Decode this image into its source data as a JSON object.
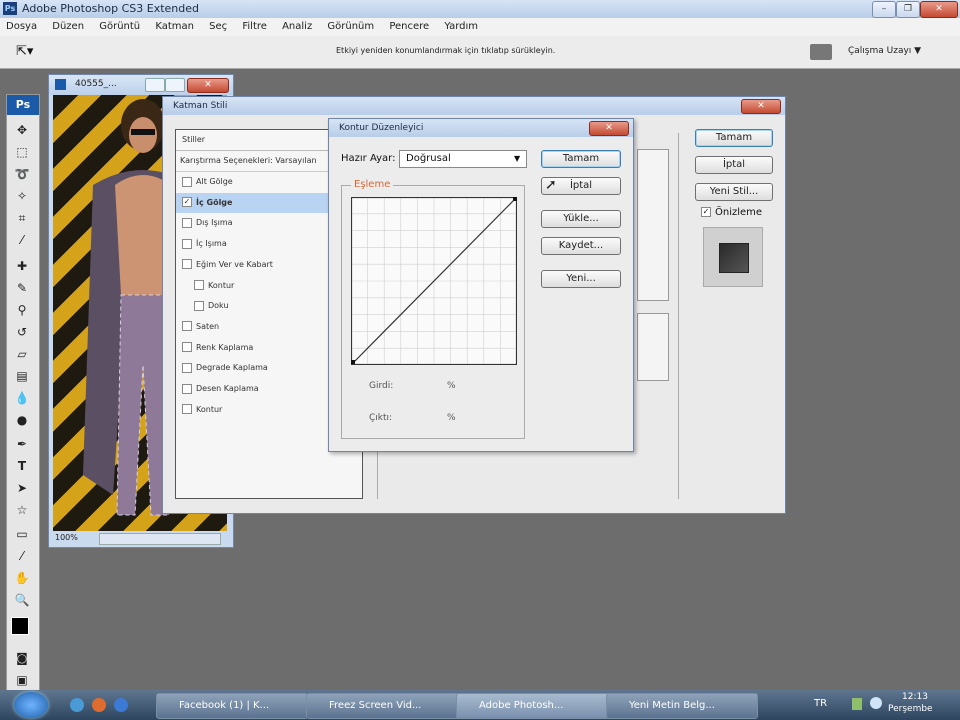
{
  "app": {
    "title": "Adobe Photoshop CS3 Extended",
    "ps_badge": "Ps"
  },
  "window_controls": {
    "minimize": "–",
    "restore": "❐",
    "close": "✕"
  },
  "menu": [
    "Dosya",
    "Düzen",
    "Görüntü",
    "Katman",
    "Seç",
    "Filtre",
    "Analiz",
    "Görünüm",
    "Pencere",
    "Yardım"
  ],
  "options": {
    "hint": "Etkiyi yeniden konumlandırmak için tıklatıp sürükleyin.",
    "workspace": "Çalışma Uzayı ▼"
  },
  "document": {
    "title": "40555_...",
    "zoom": "100%"
  },
  "layer_style": {
    "title": "Katman Stili",
    "list_header": "Stiller",
    "blend_row": "Karıştırma Seçenekleri: Varsayılan",
    "items": [
      {
        "label": "Alt Gölge",
        "checked": false,
        "selected": false,
        "indent": false
      },
      {
        "label": "İç Gölge",
        "checked": true,
        "selected": true,
        "indent": false
      },
      {
        "label": "Dış Işıma",
        "checked": false,
        "selected": false,
        "indent": false
      },
      {
        "label": "İç Işıma",
        "checked": false,
        "selected": false,
        "indent": false
      },
      {
        "label": "Eğim Ver ve Kabart",
        "checked": false,
        "selected": false,
        "indent": false
      },
      {
        "label": "Kontur",
        "checked": false,
        "selected": false,
        "indent": true
      },
      {
        "label": "Doku",
        "checked": false,
        "selected": false,
        "indent": true
      },
      {
        "label": "Saten",
        "checked": false,
        "selected": false,
        "indent": false
      },
      {
        "label": "Renk Kaplama",
        "checked": false,
        "selected": false,
        "indent": false
      },
      {
        "label": "Degrade Kaplama",
        "checked": false,
        "selected": false,
        "indent": false
      },
      {
        "label": "Desen Kaplama",
        "checked": false,
        "selected": false,
        "indent": false
      },
      {
        "label": "Kontur",
        "checked": false,
        "selected": false,
        "indent": false
      }
    ],
    "buttons": {
      "ok": "Tamam",
      "cancel": "İptal",
      "new_style": "Yeni Stil..."
    },
    "preview_label": "Önizleme",
    "preview_checked": true
  },
  "contour_editor": {
    "title": "Kontur Düzenleyici",
    "preset_label": "Hazır Ayar:",
    "preset_value": "Doğrusal",
    "group_label": "Eşleme",
    "input_label": "Girdi:",
    "output_label": "Çıktı:",
    "percent": "%",
    "buttons": {
      "ok": "Tamam",
      "cancel": "İptal",
      "load": "Yükle...",
      "save": "Kaydet...",
      "new": "Yeni..."
    }
  },
  "taskbar": {
    "items": [
      "Facebook (1) | K...",
      "Freez Screen Vid...",
      "Adobe Photosh...",
      "Yeni Metin Belg..."
    ],
    "active_index": 2,
    "lang": "TR",
    "time": "12:13",
    "day": "Perşembe"
  },
  "colors": {
    "accent": "#3c7fb1",
    "selection": "#b9d3f3"
  }
}
